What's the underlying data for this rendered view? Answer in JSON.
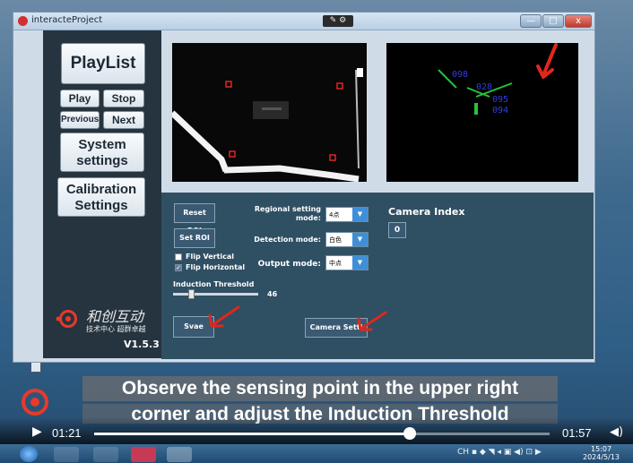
{
  "window": {
    "title": "interacteProject",
    "mid_badge": "✎ ⚙",
    "min_glyph": "—",
    "max_glyph": "□",
    "close_glyph": "x"
  },
  "sidebar": {
    "playlist": "PlayList",
    "play": "Play",
    "stop": "Stop",
    "previous": "Previous",
    "next": "Next",
    "system_settings": "System settings",
    "calibration_settings": "Calibration Settings",
    "logo_cn": "和创互动",
    "logo_sub": "技术中心 超群卓越",
    "version": "V1.5.3"
  },
  "camera2": {
    "labels": [
      "098",
      "028",
      "095",
      "094"
    ]
  },
  "controls": {
    "reset_roi": "Reset ROI",
    "set_roi": "Set ROI",
    "regional_label": "Regional setting mode:",
    "regional_value": "4点",
    "detection_label": "Detection mode:",
    "detection_value": "白色",
    "output_label": "Output mode:",
    "output_value": "中点",
    "flip_vertical": "Flip Vertical",
    "flip_vertical_checked": false,
    "flip_horizontal": "Flip Horizontal",
    "flip_horizontal_checked": true,
    "threshold_label": "Induction Threshold",
    "threshold_value": "46",
    "threshold_fraction": 0.18,
    "save": "Svae",
    "camera_settings": "Camera Setti",
    "camera_index_label": "Camera Index",
    "camera_index_value": "0"
  },
  "captions": {
    "line1": "Observe the sensing point in the upper right",
    "line2": "corner and adjust the Induction Threshold"
  },
  "player": {
    "current_time": "01:21",
    "total_time": "01:57",
    "progress_fraction": 0.692
  },
  "taskbar": {
    "clock_time": "15:07",
    "clock_date": "2024/5/13",
    "tray_text": "CH ▪ ◆ ◥ ◂ ▣ ◀) ⊡ ▶"
  },
  "colors": {
    "accent_blue": "#3f8fd6",
    "panel": "#2f4f63",
    "annotation_red": "#e0271d",
    "detect_green": "#27c23a",
    "detect_blue": "#2f3fe0"
  }
}
